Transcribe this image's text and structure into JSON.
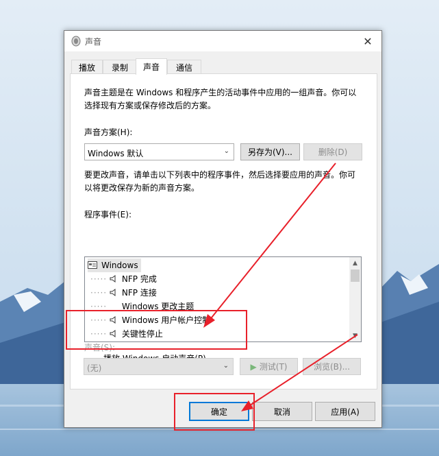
{
  "window": {
    "title": "声音",
    "close": "✕"
  },
  "tabs": [
    {
      "label": "播放"
    },
    {
      "label": "录制"
    },
    {
      "label": "声音"
    },
    {
      "label": "通信"
    }
  ],
  "panel": {
    "description1_line1": "声音主题是在 Windows 和程序产生的活动事件中应用的一组声音。你可以",
    "description1_line2": "选择现有方案或保存修改后的方案。",
    "scheme_label": "声音方案(H):",
    "scheme_value": "Windows 默认",
    "save_as_label": "另存为(V)...",
    "delete_label": "删除(D)",
    "description2_line1": "要更改声音，请单击以下列表中的程序事件，然后选择要应用的声音。你可",
    "description2_line2": "以将更改保存为新的声音方案。",
    "events_label": "程序事件(E):",
    "events": [
      {
        "label": "Windows",
        "icon": "window-icon",
        "level": 0
      },
      {
        "label": "NFP 完成",
        "icon": "speaker-icon",
        "level": 1
      },
      {
        "label": "NFP 连接",
        "icon": "speaker-icon",
        "level": 1
      },
      {
        "label": "Windows 更改主题",
        "icon": "",
        "level": 1
      },
      {
        "label": "Windows 用户帐户控制",
        "icon": "speaker-icon",
        "level": 1
      },
      {
        "label": "关键性停止",
        "icon": "speaker-icon",
        "level": 1
      }
    ],
    "startup_sound_label": "播放 Windows 启动声音(P)",
    "startup_sound_checked": false,
    "sound_label": "声音(S):",
    "sound_value": "(无)",
    "test_label": "测试(T)",
    "browse_label": "浏览(B)..."
  },
  "footer": {
    "ok_label": "确定",
    "cancel_label": "取消",
    "apply_label": "应用(A)"
  },
  "colors": {
    "annotation": "#e8202a",
    "sky": "#cfe3f3",
    "mountain": "#5a86b6",
    "water": "#8fb3d3"
  }
}
